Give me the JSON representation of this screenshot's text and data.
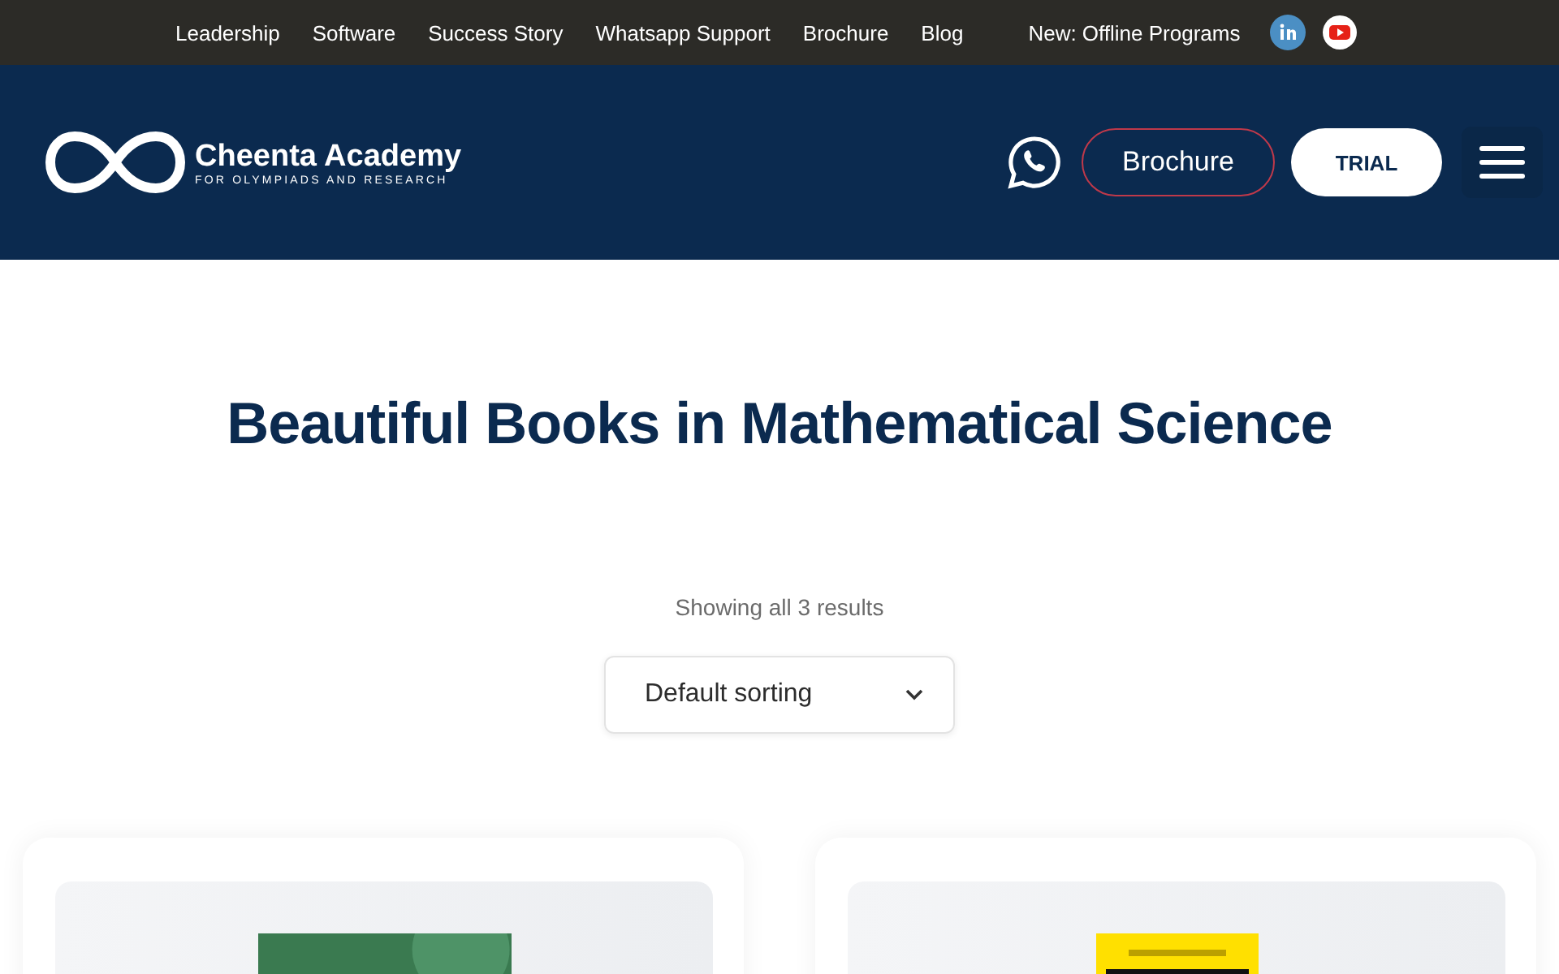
{
  "top_bar": {
    "links": [
      "Leadership",
      "Software",
      "Success Story",
      "Whatsapp Support",
      "Brochure",
      "Blog"
    ],
    "promo": "New: Offline Programs"
  },
  "header": {
    "brand": {
      "name": "Cheenta Academy",
      "tagline": "FOR OLYMPIADS AND RESEARCH"
    },
    "brochure_button": "Brochure",
    "trial_button": "TRIAL"
  },
  "page": {
    "title": "Beautiful Books in Mathematical Science",
    "result_count": "Showing all 3 results",
    "sorting": {
      "value": "Default sorting"
    }
  }
}
